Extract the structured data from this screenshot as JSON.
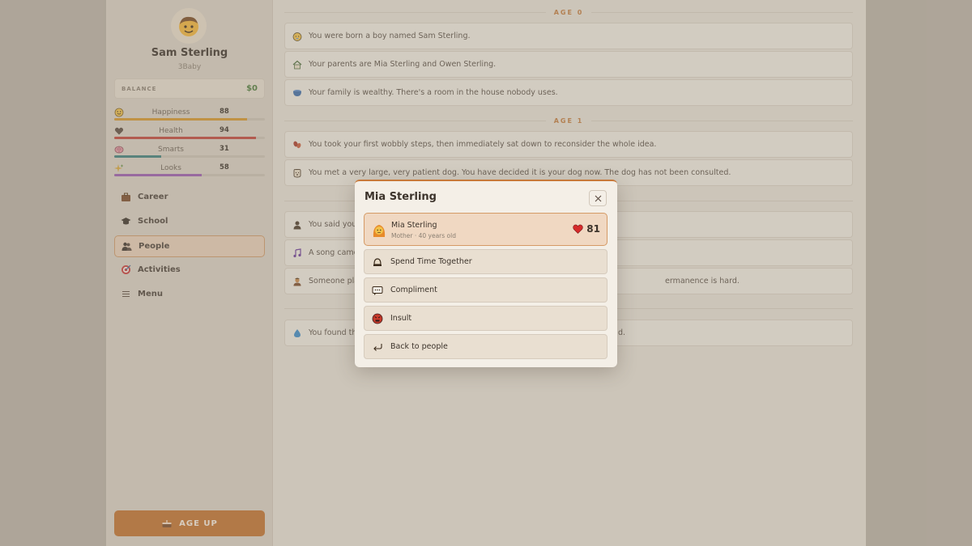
{
  "player": {
    "name": "Sam Sterling",
    "subtitle": "3Baby",
    "balance_label": "BALANCE",
    "balance_value": "$0"
  },
  "stats": [
    {
      "name": "Happiness",
      "value": 88,
      "color": "#d4952b"
    },
    {
      "name": "Health",
      "value": 94,
      "color": "#c0443a"
    },
    {
      "name": "Smarts",
      "value": 31,
      "color": "#3d7f7c"
    },
    {
      "name": "Looks",
      "value": 58,
      "color": "#9a5bb0"
    }
  ],
  "nav": [
    {
      "label": "Career",
      "icon": "briefcase-icon"
    },
    {
      "label": "School",
      "icon": "graduation-cap-icon"
    },
    {
      "label": "People",
      "icon": "people-icon",
      "active": true
    },
    {
      "label": "Activities",
      "icon": "target-icon"
    },
    {
      "label": "Menu",
      "icon": "menu-icon"
    }
  ],
  "age_up_label": "AGE UP",
  "feed": {
    "age0_label": "AGE 0",
    "age1_label": "AGE 1",
    "events": [
      "You were born a boy named Sam Sterling.",
      "Your parents are Mia Sterling and Owen Sterling.",
      "Your family is wealthy. There's a room in the house nobody uses.",
      "You took your first wobbly steps, then immediately sat down to reconsider the whole idea.",
      "You met a very large, very patient dog. You have decided it is your dog now. The dog has not been consulted.",
      "You said you",
      "A song came",
      "Someone pla",
      "ermanence is hard.",
      "You found th",
      "d."
    ]
  },
  "modal": {
    "title": "Mia Sterling",
    "person": {
      "name": "Mia Sterling",
      "meta": "Mother · 40 years old",
      "relationship": "81"
    },
    "actions": [
      {
        "label": "Spend Time Together",
        "icon": "bell-icon"
      },
      {
        "label": "Compliment",
        "icon": "speech-bubble-icon"
      },
      {
        "label": "Insult",
        "icon": "angry-face-icon"
      },
      {
        "label": "Back to people",
        "icon": "return-arrow-icon"
      }
    ]
  }
}
